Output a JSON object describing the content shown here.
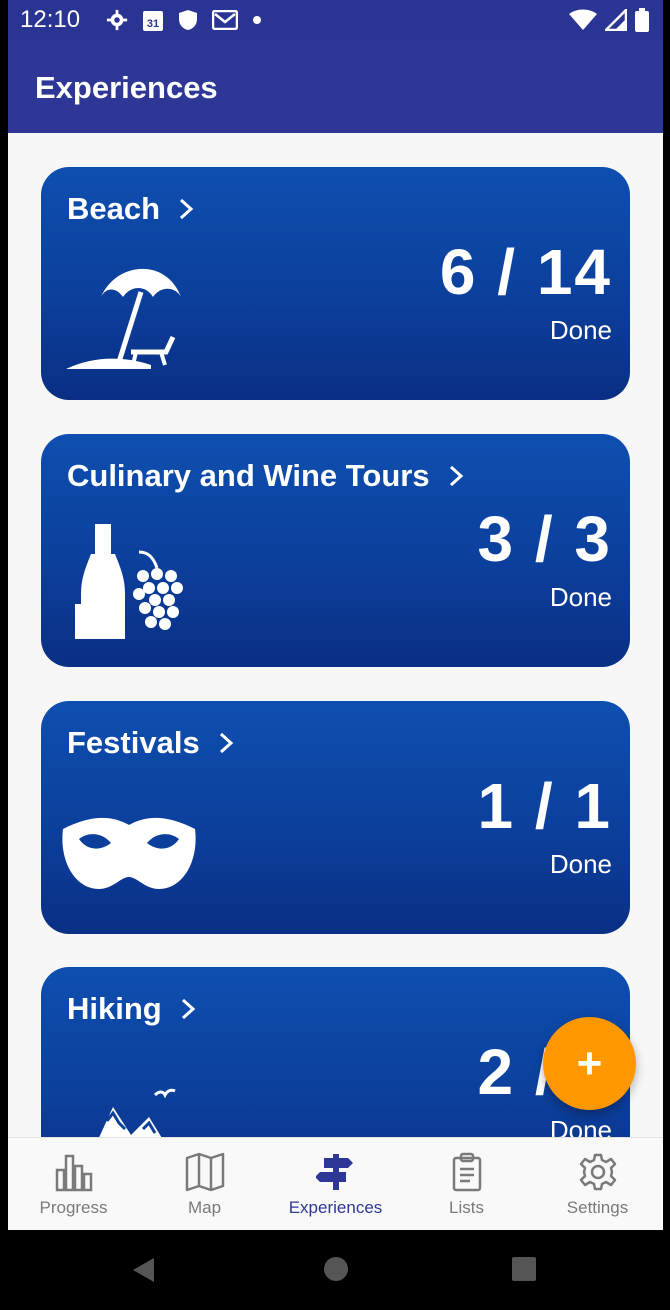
{
  "status_bar": {
    "time": "12:10",
    "calendar_day": "31",
    "left_icons": [
      "gear-icon",
      "calendar-icon",
      "shield-icon",
      "gmail-icon",
      "dot-icon"
    ],
    "right_icons": [
      "wifi-icon",
      "signal-icon",
      "battery-icon"
    ]
  },
  "app_bar": {
    "title": "Experiences"
  },
  "cards": [
    {
      "title": "Beach",
      "count": "6 / 14",
      "done_label": "Done",
      "icon": "beach-umbrella-icon"
    },
    {
      "title": "Culinary and Wine Tours",
      "count": "3 / 3",
      "done_label": "Done",
      "icon": "wine-grapes-icon"
    },
    {
      "title": "Festivals",
      "count": "1 / 1",
      "done_label": "Done",
      "icon": "mask-icon"
    },
    {
      "title": "Hiking",
      "count": "2 / 4",
      "done_label": "Done",
      "icon": "mountain-icon"
    }
  ],
  "fab": {
    "label": "+"
  },
  "bottom_nav": [
    {
      "label": "Progress",
      "icon": "bar-chart-icon",
      "active": false
    },
    {
      "label": "Map",
      "icon": "map-icon",
      "active": false
    },
    {
      "label": "Experiences",
      "icon": "signpost-icon",
      "active": true
    },
    {
      "label": "Lists",
      "icon": "clipboard-icon",
      "active": false
    },
    {
      "label": "Settings",
      "icon": "settings-icon",
      "active": false
    }
  ],
  "colors": {
    "primary": "#2e3795",
    "card_top": "#0e4fb0",
    "card_bottom": "#0a2f84",
    "accent": "#ff9800",
    "nav_inactive": "#7a7a7a"
  }
}
